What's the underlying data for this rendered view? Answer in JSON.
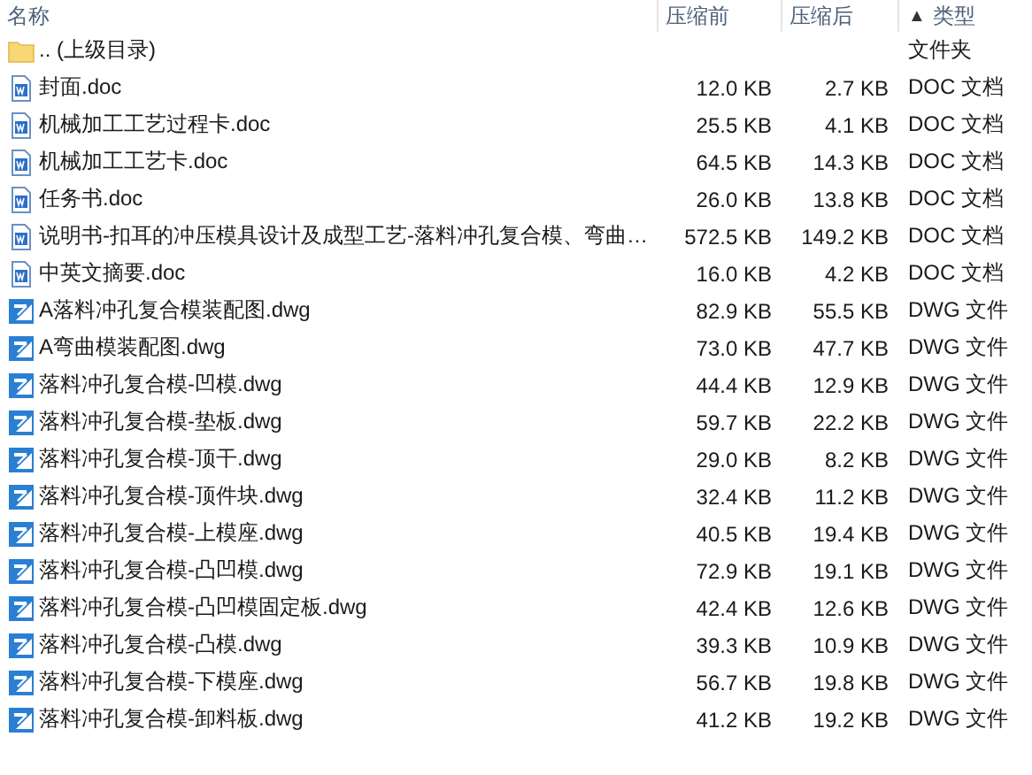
{
  "columns": [
    {
      "label": "名称"
    },
    {
      "label": "压缩前"
    },
    {
      "label": "压缩后"
    },
    {
      "label": "类型",
      "sort": "▲"
    }
  ],
  "rows": [
    {
      "kind": "folder",
      "name": ".. (上级目录)",
      "type": "文件夹"
    },
    {
      "kind": "doc",
      "name": "封面.doc",
      "size": "12.0 KB",
      "packed": "2.7 KB",
      "type": "DOC 文档"
    },
    {
      "kind": "doc",
      "name": "机械加工工艺过程卡.doc",
      "size": "25.5 KB",
      "packed": "4.1 KB",
      "type": "DOC 文档"
    },
    {
      "kind": "doc",
      "name": "机械加工工艺卡.doc",
      "size": "64.5 KB",
      "packed": "14.3 KB",
      "type": "DOC 文档"
    },
    {
      "kind": "doc",
      "name": "任务书.doc",
      "size": "26.0 KB",
      "packed": "13.8 KB",
      "type": "DOC 文档"
    },
    {
      "kind": "doc",
      "name": "说明书-扣耳的冲压模具设计及成型工艺-落料冲孔复合模、弯曲…",
      "size": "572.5 KB",
      "packed": "149.2 KB",
      "type": "DOC 文档"
    },
    {
      "kind": "doc",
      "name": "中英文摘要.doc",
      "size": "16.0 KB",
      "packed": "4.2 KB",
      "type": "DOC 文档"
    },
    {
      "kind": "dwg",
      "name": "A落料冲孔复合模装配图.dwg",
      "size": "82.9 KB",
      "packed": "55.5 KB",
      "type": "DWG 文件"
    },
    {
      "kind": "dwg",
      "name": "A弯曲模装配图.dwg",
      "size": "73.0 KB",
      "packed": "47.7 KB",
      "type": "DWG 文件"
    },
    {
      "kind": "dwg",
      "name": "落料冲孔复合模-凹模.dwg",
      "size": "44.4 KB",
      "packed": "12.9 KB",
      "type": "DWG 文件"
    },
    {
      "kind": "dwg",
      "name": "落料冲孔复合模-垫板.dwg",
      "size": "59.7 KB",
      "packed": "22.2 KB",
      "type": "DWG 文件"
    },
    {
      "kind": "dwg",
      "name": "落料冲孔复合模-顶干.dwg",
      "size": "29.0 KB",
      "packed": "8.2 KB",
      "type": "DWG 文件"
    },
    {
      "kind": "dwg",
      "name": "落料冲孔复合模-顶件块.dwg",
      "size": "32.4 KB",
      "packed": "11.2 KB",
      "type": "DWG 文件"
    },
    {
      "kind": "dwg",
      "name": "落料冲孔复合模-上模座.dwg",
      "size": "40.5 KB",
      "packed": "19.4 KB",
      "type": "DWG 文件"
    },
    {
      "kind": "dwg",
      "name": "落料冲孔复合模-凸凹模.dwg",
      "size": "72.9 KB",
      "packed": "19.1 KB",
      "type": "DWG 文件"
    },
    {
      "kind": "dwg",
      "name": "落料冲孔复合模-凸凹模固定板.dwg",
      "size": "42.4 KB",
      "packed": "12.6 KB",
      "type": "DWG 文件"
    },
    {
      "kind": "dwg",
      "name": "落料冲孔复合模-凸模.dwg",
      "size": "39.3 KB",
      "packed": "10.9 KB",
      "type": "DWG 文件"
    },
    {
      "kind": "dwg",
      "name": "落料冲孔复合模-下模座.dwg",
      "size": "56.7 KB",
      "packed": "19.8 KB",
      "type": "DWG 文件"
    },
    {
      "kind": "dwg",
      "name": "落料冲孔复合模-卸料板.dwg",
      "size": "41.2 KB",
      "packed": "19.2 KB",
      "type": "DWG 文件"
    }
  ]
}
